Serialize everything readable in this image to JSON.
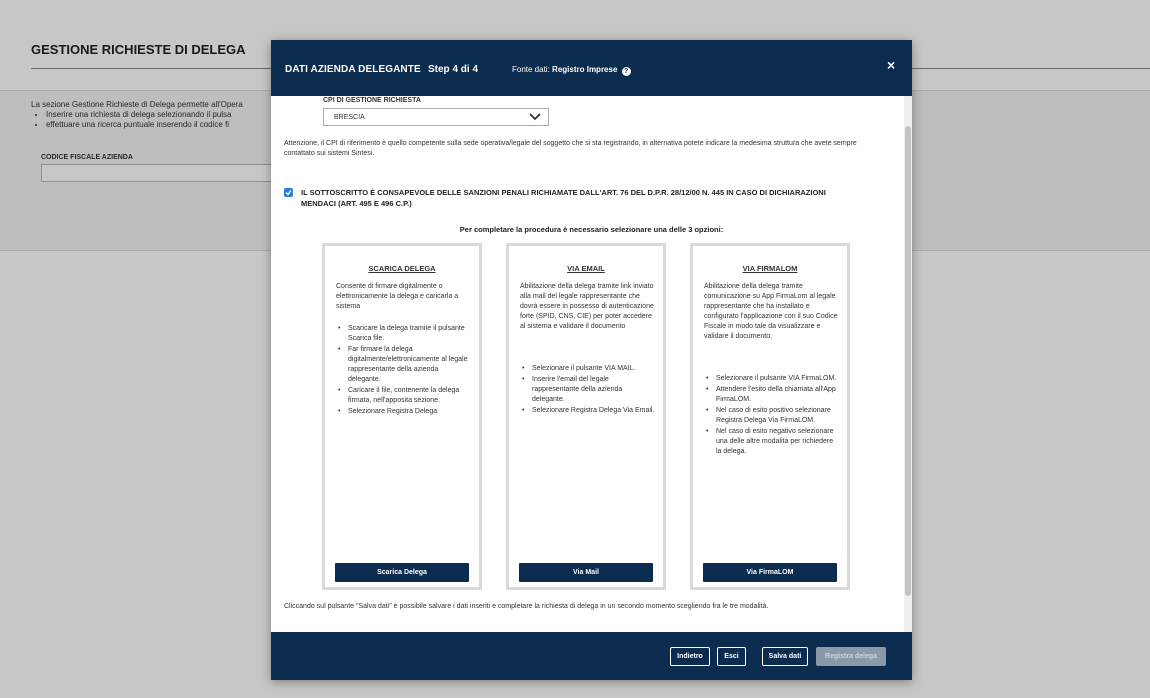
{
  "background": {
    "title": "GESTIONE RICHIESTE DI DELEGA",
    "intro": "La sezione Gestione Richieste di Delega permette all'Opera",
    "bullets": [
      "Inserire una richiesta di delega selezionando il pulsa",
      "effettuare una ricerca puntuale inserendo il codice fi"
    ],
    "cf_label": "CODICE FISCALE AZIENDA"
  },
  "modal": {
    "title": "DATI AZIENDA DELEGANTE",
    "step": "Step 4 di 4",
    "source_prefix": "Fonte dati:",
    "source_value": "Registro Imprese",
    "help_icon": "?",
    "close_icon": "×",
    "cpi_label": "CPI DI GESTIONE RICHIESTA",
    "cpi_value": "BRESCIA",
    "notice": "Attenzione, il CPI di riferimento è quello competente sulla sede operativa/legale del soggetto che si sta registrando, in alternativa potete indicare la medesima struttura che avete sempre contattato sui sistemi Sintesi.",
    "declaration": "IL SOTTOSCRITTO È CONSAPEVOLE DELLE SANZIONI PENALI RICHIAMATE DALL'ART. 76 DEL D.P.R. 28/12/00 N. 445 IN CASO DI DICHIARAZIONI MENDACI (ART. 495 E 496 C.P.)",
    "declaration_checked": true,
    "complete_note": "Per completare la procedura è necessario selezionare una delle 3 opzioni:",
    "options": [
      {
        "title": "SCARICA DELEGA",
        "desc": "Consente di firmare digitalmente o elettronicamente la delega e caricarla a sistema",
        "steps": [
          "Scaricare la delega tramite il pulsante Scarica file.",
          "Far firmare la delega digitalmente/elettronicamente al legale rappresentante della azienda delegante.",
          "Caricare il file, contenente la delega firmata, nell'apposita sezione.",
          "Selezionare Registra Delega"
        ],
        "button": "Scarica Delega"
      },
      {
        "title": "VIA EMAIL",
        "desc": "Abilitazione della delega tramite link inviato alla mail del legale rappresentante che dovrà essere in possesso di autenticazione forte (SPID, CNS, CIE) per poter accedere al sistema e validare il documento",
        "steps": [
          "Selezionare il pulsante VIA MAIL.",
          "Inserire l'email del legale rappresentante della azienda delegante.",
          "Selezionare Registra Delega Via Email."
        ],
        "button": "Via Mail"
      },
      {
        "title": "VIA FIRMALOM",
        "desc": "Abilitazione della delega tramite comunicazione su App FirmaLom al legale rappresentante che ha installato e configurato l'applicazione con il suo Codice Fiscale in modo tale da visualizzare e validare il documento.",
        "steps": [
          "Selezionare il pulsante VIA FirmaLOM.",
          "Attendere l'esito della chiamata all'App FirmaLOM.",
          "Nel caso di esito positivo selezionare Registra Delega Via FirmaLOM.",
          "Nel caso di esito negativo selezionare una delle altre modalità per richiedere la delega."
        ],
        "button": "Via FirmaLOM"
      }
    ],
    "footer_note": "Cliccando sul pulsante \"Salva dati\" è possibile salvare i dati inseriti e completare la richiesta di delega in un secondo momento scegliendo fra le tre modalità.",
    "footer_buttons": {
      "back": "Indietro",
      "exit": "Esci",
      "save": "Salva dati",
      "register": "Registra delega"
    }
  }
}
